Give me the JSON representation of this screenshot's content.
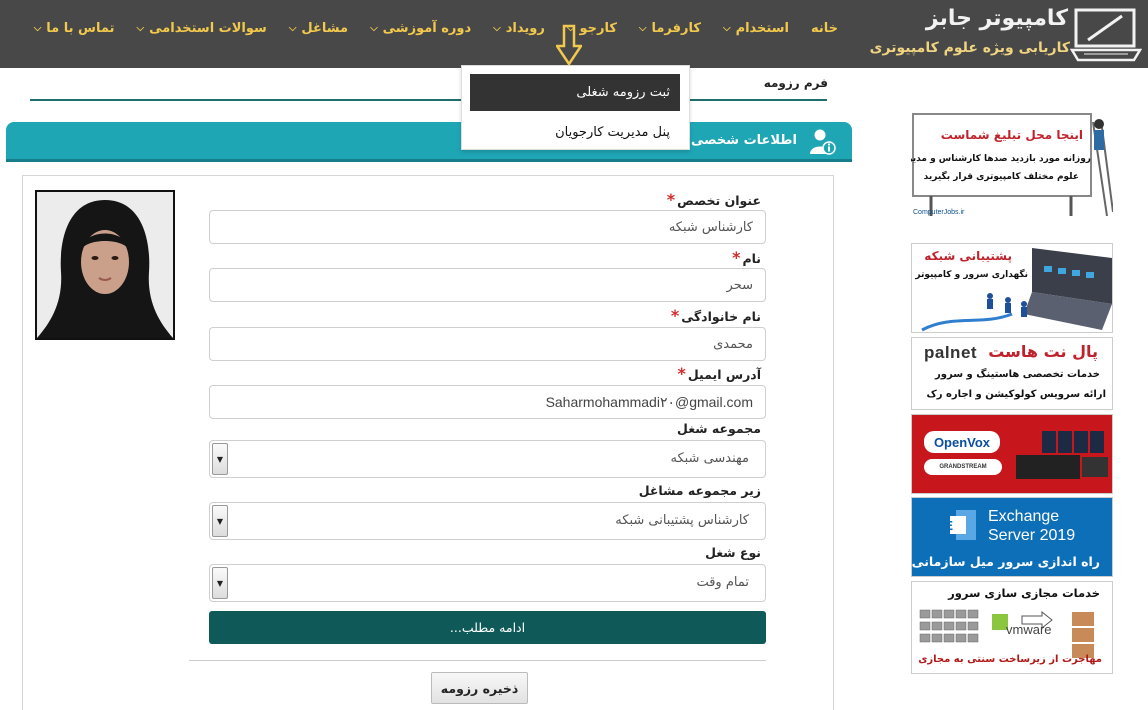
{
  "site": {
    "title": "کامپیوتر جابز",
    "subtitle": "کاریابی ویژه علوم کامپیوتری"
  },
  "nav": {
    "items": [
      {
        "label": "خانه",
        "has_dropdown": false
      },
      {
        "label": "استخدام",
        "has_dropdown": true
      },
      {
        "label": "کارفرما",
        "has_dropdown": true
      },
      {
        "label": "کارجو",
        "has_dropdown": true
      },
      {
        "label": "رویداد",
        "has_dropdown": true
      },
      {
        "label": "دوره آموزشی",
        "has_dropdown": true
      },
      {
        "label": "مشاغل",
        "has_dropdown": true
      },
      {
        "label": "سوالات استخدامی",
        "has_dropdown": true
      },
      {
        "label": "تماس با ما",
        "has_dropdown": true
      }
    ]
  },
  "dropdown": {
    "items": [
      "ثبت رزومه شغلی",
      "پنل مدیریت کارجویان"
    ],
    "active_index": 0
  },
  "form": {
    "title": "فرم رزومه",
    "section_title": "اطلاعات شخصی",
    "fields": [
      {
        "label": "عنوان تخصص",
        "required": true,
        "value": "کارشناس شبکه"
      },
      {
        "label": "نام",
        "required": true,
        "value": "سحر"
      },
      {
        "label": "نام خانوادگی",
        "required": true,
        "value": "محمدی"
      },
      {
        "label": "آدرس ایمیل",
        "required": true,
        "value": "Saharmohammadi۲۰@gmail.com"
      }
    ],
    "selects": [
      {
        "label": "مجموعه شغل",
        "value": "مهندسی شبکه"
      },
      {
        "label": "زیر مجموعه مشاغل",
        "value": "کارشناس پشتیبانی شبکه"
      },
      {
        "label": "نوع شغل",
        "value": "تمام وقت"
      }
    ],
    "required_mark": "*",
    "more_button": "ادامه مطلب...",
    "save_button": "ذخیره رزومه"
  },
  "ads": {
    "ad1": {
      "line1": "اینجا محل تبلیغ شماست",
      "line2": "روزانه مورد بازدید صدها کارشناس و مدیر",
      "line3": "علوم مختلف کامپیوتری قرار بگیرید",
      "footer": "ComputerJobs.ir"
    },
    "ad2": {
      "line1": "پشتیبانی شبکه",
      "line2": "نگهداری سرور و کامپیوتر"
    },
    "ad3": {
      "brand": "palnet",
      "line1": "پال نت هاست",
      "line2": "خدمات تخصصی هاستینگ و سرور",
      "line3": "ارائه سرویس کولوکیشن و اجاره رک"
    },
    "ad4": {
      "brand1": "OpenVox",
      "brand2": "GRANDSTREAM"
    },
    "ad5": {
      "line1": "Exchange",
      "line2": "Server 2019",
      "line3": "راه اندازی سرور میل سازمانی"
    },
    "ad6": {
      "line1": "خدمات مجازی سازی سرور",
      "brand": "vmware",
      "line2": "مهاجرت از زیرساخت سنتی به مجازی"
    }
  },
  "colors": {
    "header_bg": "#484848",
    "nav_text": "#f2c94c",
    "section_bar": "#1fa6b5",
    "more_button": "#0f5a58",
    "required": "#d52b2b"
  }
}
